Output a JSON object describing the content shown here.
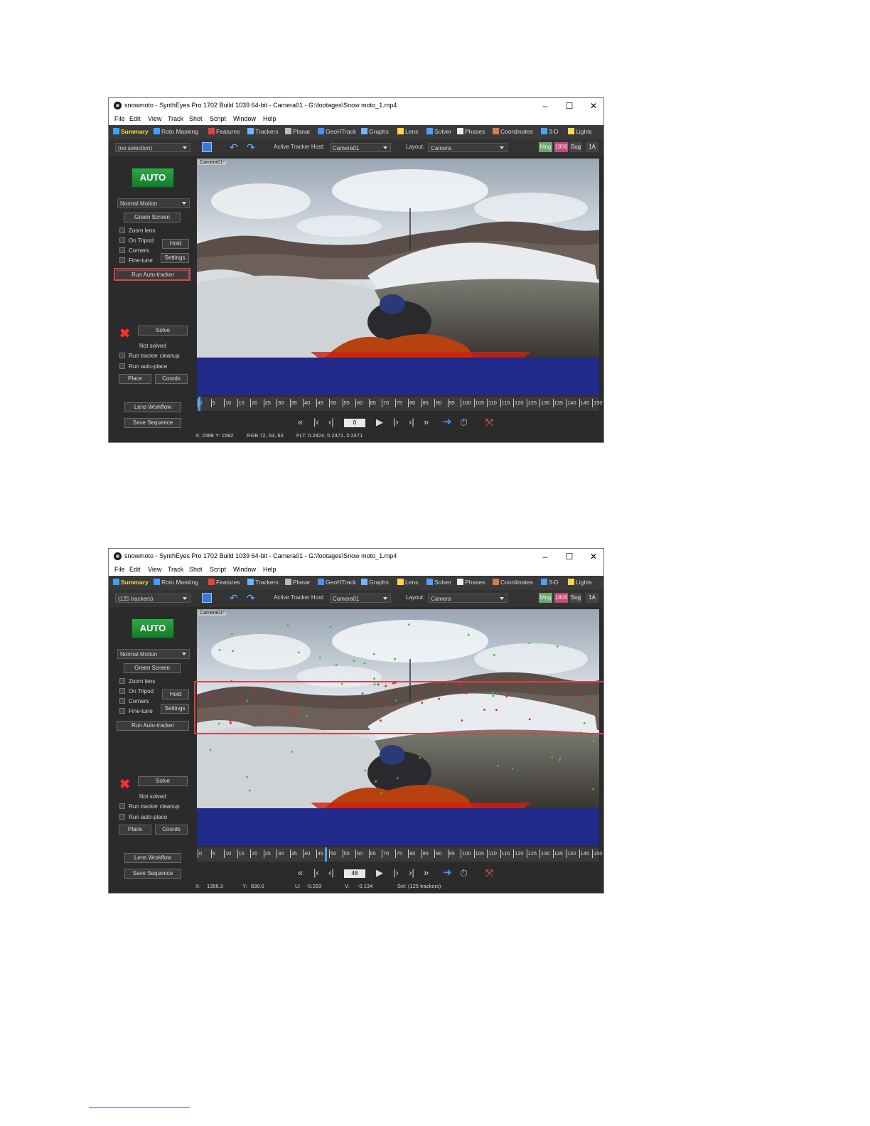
{
  "screenshots": [
    {
      "title": "snowmoto - SynthEyes Pro 1702 Build 1039 64-bit - Camera01 - G:\\footages\\Snow moto_1.mp4",
      "window_controls": [
        "–",
        "☐",
        "✕"
      ],
      "menu": [
        "File",
        "Edit",
        "View",
        "Track",
        "Shot",
        "Script",
        "Window",
        "Help"
      ],
      "tabs": [
        "Summary",
        "Roto Masking",
        "Features",
        "Trackers",
        "Planar",
        "GeoHTrack",
        "Graphs",
        "Lens",
        "Solver",
        "Phases",
        "Coordinates",
        "3-D",
        "Lights"
      ],
      "selection": "(no selection)",
      "active_tracker_host_label": "Active Tracker Host:",
      "active_tracker_host": "Camera01",
      "layout_label": "Layout:",
      "layout": "Camera",
      "toolbar_right": [
        "Mog",
        "1806",
        "Sug",
        "1A"
      ],
      "auto_label": "AUTO",
      "motion": "Normal Motion",
      "green_screen": "Green Screen",
      "checks": [
        "Zoom lens",
        "On Tripod",
        "Corners",
        "Fine-tune"
      ],
      "hold": "Hold",
      "settings": "Settings",
      "run_auto_tracker": "Run Auto-tracker",
      "solve": "Solve",
      "solve_status": "Not solved",
      "run_tracker_cleanup": "Run tracker cleanup",
      "run_auto_place": "Run auto-place",
      "place": "Place",
      "coords": "Coords",
      "lens_workflow": "Lens Workflow",
      "save_sequence": "Save Sequence",
      "camera_label": "Camera01*",
      "ticks": [
        "0",
        "5",
        "10",
        "15",
        "20",
        "25",
        "30",
        "35",
        "40",
        "45",
        "50",
        "55",
        "60",
        "65",
        "70",
        "75",
        "80",
        "85",
        "90",
        "95",
        "100",
        "105",
        "110",
        "115",
        "120",
        "125",
        "130",
        "135",
        "140",
        "145",
        "150"
      ],
      "frame": "0",
      "playhead_fraction": 0,
      "status": [
        "X: 2398",
        "Y: 1582",
        "RGB 72, 63, 63",
        "FLT: 0.2824, 0.2471, 0.2471"
      ],
      "highlight": "run-auto-tracker",
      "show_trackers": false
    },
    {
      "title": "snowmoto - SynthEyes Pro 1702 Build 1039 64-bit - Camera01 - G:\\footages\\Snow moto_1.mp4",
      "window_controls": [
        "–",
        "☐",
        "✕"
      ],
      "menu": [
        "File",
        "Edit",
        "View",
        "Track",
        "Shot",
        "Script",
        "Window",
        "Help"
      ],
      "tabs": [
        "Summary",
        "Roto Masking",
        "Features",
        "Trackers",
        "Planar",
        "GeoHTrack",
        "Graphs",
        "Lens",
        "Solver",
        "Phases",
        "Coordinates",
        "3-D",
        "Lights"
      ],
      "selection": "(125 trackers)",
      "active_tracker_host_label": "Active Tracker Host:",
      "active_tracker_host": "Camera01",
      "layout_label": "Layout:",
      "layout": "Camera",
      "toolbar_right": [
        "Mog",
        "1806",
        "Sug",
        "1A"
      ],
      "auto_label": "AUTO",
      "motion": "Normal Motion",
      "green_screen": "Green Screen",
      "checks": [
        "Zoom lens",
        "On Tripod",
        "Corners",
        "Fine-tune"
      ],
      "hold": "Hold",
      "settings": "Settings",
      "run_auto_tracker": "Run Auto-tracker",
      "solve": "Solve",
      "solve_status": "Not solved",
      "run_tracker_cleanup": "Run tracker cleanup",
      "run_auto_place": "Run auto-place",
      "place": "Place",
      "coords": "Coords",
      "lens_workflow": "Lens Workflow",
      "save_sequence": "Save Sequence",
      "camera_label": "Camera01*",
      "ticks": [
        "0",
        "5",
        "10",
        "15",
        "20",
        "25",
        "30",
        "35",
        "40",
        "45",
        "50",
        "55",
        "60",
        "65",
        "70",
        "75",
        "80",
        "85",
        "90",
        "95",
        "100",
        "105",
        "110",
        "115",
        "120",
        "125",
        "130",
        "135",
        "140",
        "145",
        "150"
      ],
      "frame": "48",
      "playhead_fraction": 0.32,
      "status": [
        "X:",
        "1356.3",
        "Y:",
        "830.6",
        "U:",
        "-0.293",
        "V:",
        "-0.134",
        "Sel: (125 trackers)"
      ],
      "highlight": "viewport-band",
      "show_trackers": true
    }
  ],
  "colors": {
    "tracker_red": "#e02020",
    "tracker_green": "#22cc33",
    "highlight": "#e04040",
    "auto_green": "#1f9a3a"
  }
}
